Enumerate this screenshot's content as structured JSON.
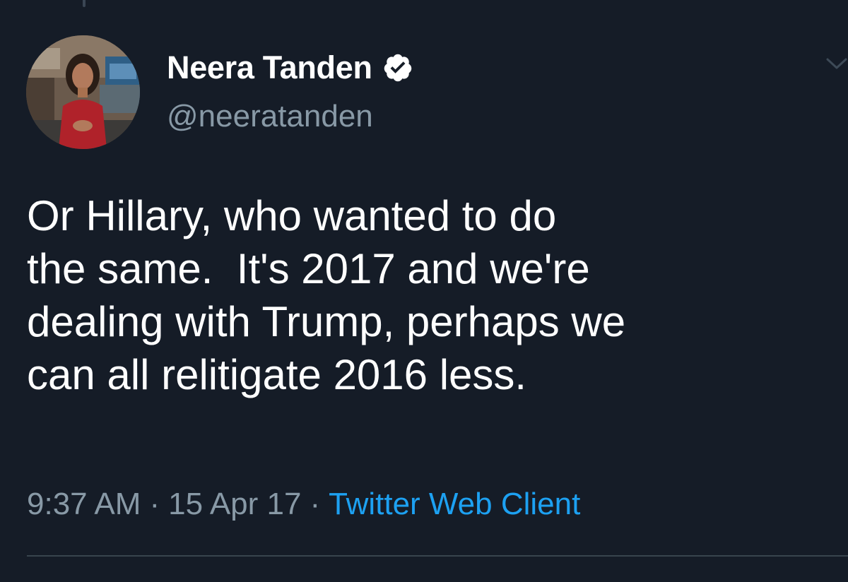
{
  "tweet": {
    "author": {
      "display_name": "Neera Tanden",
      "handle": "@neeratanden",
      "verified": true
    },
    "text": "Or Hillary, who wanted to do\nthe same.  It's 2017 and we're\ndealing with Trump, perhaps we\ncan all relitigate 2016 less.",
    "time": "9:37 AM",
    "date": "15 Apr 17",
    "separator": "·",
    "source": "Twitter Web Client"
  },
  "icons": {
    "verified": "verified-badge-icon",
    "menu": "chevron-down-icon"
  },
  "colors": {
    "background": "#151c27",
    "text_primary": "#ffffff",
    "text_secondary": "#8899a6",
    "link": "#1da1f2",
    "divider": "#38444d"
  }
}
